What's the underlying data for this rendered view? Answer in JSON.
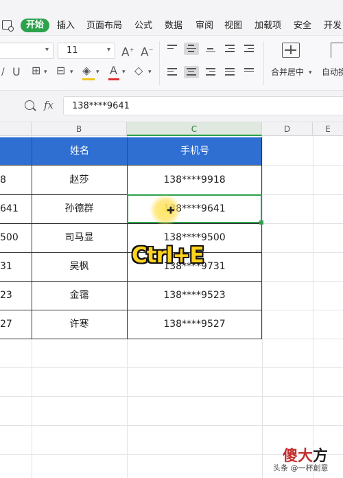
{
  "menu": {
    "items": [
      "开始",
      "插入",
      "页面布局",
      "公式",
      "数据",
      "审阅",
      "视图",
      "加载项",
      "安全",
      "开发"
    ],
    "active_index": 0
  },
  "ribbon": {
    "font_size": "11",
    "merge_label": "合并居中",
    "wrap_label": "自动换"
  },
  "formula_bar": {
    "fx_label": "fx",
    "value": "138****9641"
  },
  "columns": [
    "B",
    "C",
    "D",
    "E"
  ],
  "selected_column": "C",
  "table": {
    "headers": [
      "姓名",
      "手机号"
    ],
    "rows": [
      {
        "a_fragment": "8",
        "name": "赵莎",
        "phone": "138****9918"
      },
      {
        "a_fragment": "641",
        "name": "孙德群",
        "phone": "138****9641"
      },
      {
        "a_fragment": "500",
        "name": "司马显",
        "phone": "138****9500"
      },
      {
        "a_fragment": "31",
        "name": "吴枫",
        "phone": "138****9731"
      },
      {
        "a_fragment": "23",
        "name": "金霭",
        "phone": "138****9523"
      },
      {
        "a_fragment": "27",
        "name": "许寒",
        "phone": "138****9527"
      }
    ]
  },
  "overlay": {
    "shortcut": "Ctrl+E"
  },
  "watermark": {
    "brand_red": "傻大",
    "brand_dark": "方",
    "sub": "头条 @一杯創意"
  },
  "colors": {
    "accent_green": "#2ca24c",
    "header_blue": "#2f6fd2",
    "shortcut_yellow": "#ffd21f"
  }
}
